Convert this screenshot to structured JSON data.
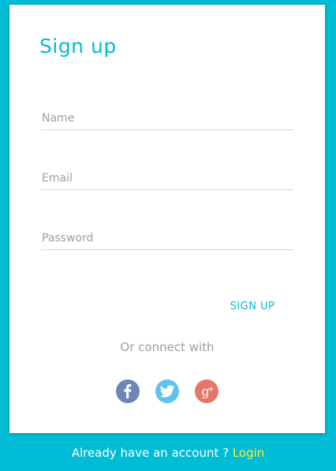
{
  "card": {
    "title": "Sign up"
  },
  "form": {
    "name_placeholder": "Name",
    "email_placeholder": "Email",
    "password_placeholder": "Password",
    "submit_label": "SIGN UP"
  },
  "social": {
    "connect_text": "Or connect with",
    "items": [
      {
        "name": "facebook",
        "icon": "facebook-icon",
        "color": "#6f84b8"
      },
      {
        "name": "twitter",
        "icon": "twitter-icon",
        "color": "#62c3ea"
      },
      {
        "name": "google-plus",
        "icon": "google-plus-icon",
        "color": "#e6766b"
      }
    ]
  },
  "footer": {
    "prompt": "Already have an account ? ",
    "login_label": "Login"
  },
  "colors": {
    "background": "#00bcd4",
    "accent": "#00bcd4",
    "link": "#ffeb3b"
  }
}
